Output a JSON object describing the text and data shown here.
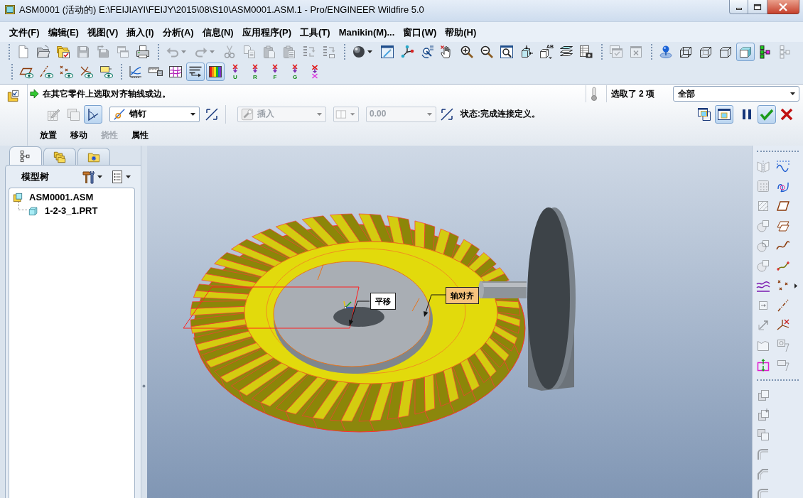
{
  "window": {
    "title": "ASM0001 (活动的) E:\\FEIJIAYI\\FEIJY\\2015\\08\\S10\\ASM0001.ASM.1 - Pro/ENGINEER Wildfire 5.0"
  },
  "menu": [
    "文件(F)",
    "编辑(E)",
    "视图(V)",
    "插入(I)",
    "分析(A)",
    "信息(N)",
    "应用程序(P)",
    "工具(T)",
    "Manikin(M)...",
    "窗口(W)",
    "帮助(H)"
  ],
  "toolbar_rows": [
    [
      [
        {
          "disabled": false
        },
        {
          "disabled": false
        },
        {
          "disabled": false
        },
        {
          "disabled": true
        },
        {
          "disabled": true
        },
        {
          "disabled": true
        },
        {
          "disabled": false
        }
      ],
      [
        {
          "disabled": true
        },
        {
          "disabled": true
        },
        {
          "disabled": true
        },
        {
          "disabled": true
        },
        {
          "disabled": true
        },
        {
          "disabled": true
        },
        {
          "disabled": true
        },
        {
          "disabled": true
        }
      ],
      [
        {
          "disabled": false
        },
        {
          "disabled": false
        },
        {
          "disabled": false
        },
        {
          "disabled": false
        },
        {
          "disabled": false
        },
        {
          "disabled": false
        },
        {
          "disabled": false
        },
        {
          "disabled": false
        },
        {
          "disabled": false
        },
        {
          "disabled": false,
          "label": "AB"
        },
        {
          "disabled": false
        },
        {
          "disabled": false
        }
      ],
      [
        {
          "disabled": true
        },
        {
          "disabled": true
        }
      ],
      [
        {
          "selected": false,
          "disabled": false
        },
        {
          "selected": false,
          "disabled": false
        },
        {
          "selected": false,
          "disabled": false
        },
        {
          "selected": false,
          "disabled": false
        },
        {
          "selected": true,
          "disabled": false
        },
        {
          "disabled": false
        },
        {
          "disabled": true
        }
      ]
    ],
    [
      [
        {
          "selected": false,
          "disabled": false
        },
        {
          "selected": false,
          "disabled": false
        },
        {
          "selected": false,
          "disabled": false
        },
        {
          "selected": false,
          "disabled": false
        },
        {
          "selected": false,
          "disabled": false
        }
      ],
      [
        {
          "disabled": false
        },
        {
          "disabled": false
        },
        {
          "disabled": false
        },
        {
          "selected": true,
          "disabled": false
        },
        {
          "selected": true,
          "disabled": false
        },
        {
          "disabled": false,
          "label": "U"
        },
        {
          "disabled": false,
          "label": "R"
        },
        {
          "disabled": false,
          "label": "F"
        },
        {
          "disabled": false,
          "label": "G"
        },
        {
          "disabled": false
        }
      ]
    ]
  ],
  "dashboard": {
    "prompt": "在其它零件上选取对齐轴线或边。",
    "selection_count": "选取了 2 项",
    "filter": "全部",
    "tool_buttons": [
      {
        "selected": false,
        "disabled": true
      },
      {
        "selected": false,
        "disabled": true
      },
      {
        "selected": true,
        "disabled": false
      }
    ],
    "connection_type": "销钉",
    "constraint_type": {
      "value": "插入",
      "disabled": true
    },
    "side_dropdown": {
      "disabled": true
    },
    "offset": {
      "value": "0.00",
      "disabled": true
    },
    "status": "状态:完成连接定义。",
    "view_buttons": [
      {
        "selected": false
      },
      {
        "selected": true
      }
    ],
    "control_buttons": [
      {
        "selected": false
      },
      {
        "selected": true
      },
      {
        "selected": false
      }
    ],
    "tabs": [
      {
        "label": "放置",
        "disabled": false
      },
      {
        "label": "移动",
        "disabled": false
      },
      {
        "label": "挠性",
        "disabled": true
      },
      {
        "label": "属性",
        "disabled": false
      }
    ]
  },
  "model_tree": {
    "tabs": [
      {
        "selected": true
      },
      {
        "selected": false
      },
      {
        "selected": false
      }
    ],
    "title": "模型树",
    "items": [
      {
        "label": "ASM0001.ASM",
        "kind": "assembly",
        "children": [
          {
            "label": "1-2-3_1.PRT",
            "kind": "part"
          }
        ]
      }
    ]
  },
  "viewport": {
    "labels": [
      {
        "kind": "drag",
        "text": "平移"
      },
      {
        "kind": "constraint",
        "text": "轴对齐"
      }
    ]
  },
  "right_toolbar": [
    {
      "disabled": true
    },
    {
      "disabled": false
    },
    {
      "disabled": true
    },
    {
      "disabled": false
    },
    {
      "disabled": true
    },
    {
      "disabled": false
    },
    {
      "disabled": true
    },
    {
      "disabled": false
    },
    {
      "disabled": true
    },
    {
      "disabled": false
    },
    {
      "disabled": true
    },
    {
      "disabled": false
    },
    {
      "disabled": false
    },
    {
      "disabled": false
    },
    {
      "disabled": true
    },
    {
      "disabled": false
    },
    {
      "disabled": true
    },
    {
      "disabled": false
    },
    {
      "disabled": true
    },
    {
      "disabled": true
    },
    {
      "disabled": false
    },
    {
      "disabled": true
    },
    {
      "disabled": true
    },
    {
      "disabled": true
    },
    {
      "disabled": true
    },
    {
      "disabled": true
    },
    {
      "disabled": true
    },
    {
      "disabled": true
    }
  ]
}
